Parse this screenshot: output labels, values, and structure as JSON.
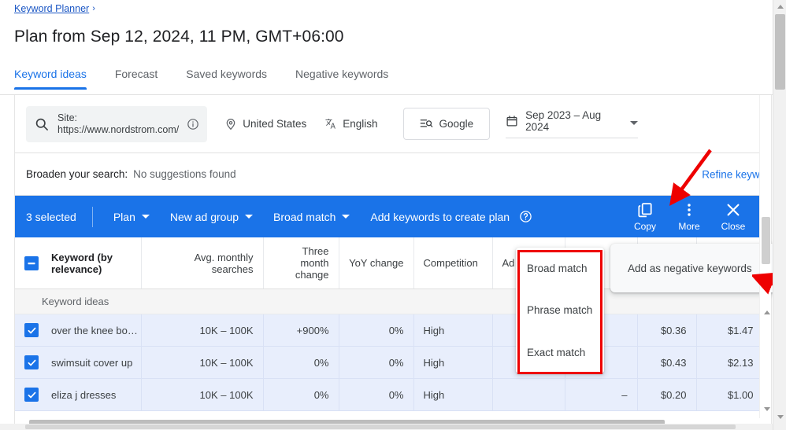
{
  "breadcrumb": {
    "label": "Keyword Planner",
    "separator": "›"
  },
  "page_title": "Plan from Sep 12, 2024, 11 PM, GMT+06:00",
  "tabs": [
    {
      "label": "Keyword ideas",
      "active": true
    },
    {
      "label": "Forecast",
      "active": false
    },
    {
      "label": "Saved keywords",
      "active": false
    },
    {
      "label": "Negative keywords",
      "active": false
    }
  ],
  "filters": {
    "site_label": "Site:",
    "site_url": "https://www.nordstrom.com/",
    "location": "United States",
    "language": "English",
    "search_network": "Google",
    "date_range": "Sep 2023 – Aug 2024"
  },
  "broaden": {
    "label": "Broaden your search:",
    "value": "No suggestions found",
    "refine_link": "Refine keywords"
  },
  "action_bar": {
    "selected_count": "3 selected",
    "plan": "Plan",
    "new_ad_group": "New ad group",
    "match_type": "Broad match",
    "add_keywords": "Add keywords to create plan",
    "copy": "Copy",
    "more": "More",
    "close": "Close"
  },
  "table": {
    "group_label": "Keyword ideas",
    "columns": [
      {
        "key": "keyword",
        "label": "Keyword (by relevance)",
        "align": "left"
      },
      {
        "key": "avg_searches",
        "label": "Avg. monthly searches",
        "align": "right"
      },
      {
        "key": "three_month",
        "label": "Three month change",
        "align": "right"
      },
      {
        "key": "yoy",
        "label": "YoY change",
        "align": "right"
      },
      {
        "key": "competition",
        "label": "Competition",
        "align": "left"
      },
      {
        "key": "ad_share",
        "label": "Ad",
        "align": "right"
      },
      {
        "key": "col7",
        "label": "",
        "align": "right"
      },
      {
        "key": "bid_low",
        "label": "",
        "align": "right"
      },
      {
        "key": "bid_high",
        "label": "",
        "align": "right"
      },
      {
        "key": "col10",
        "label": "",
        "align": "right"
      }
    ],
    "rows": [
      {
        "selected": true,
        "keyword": "over the knee bo…",
        "avg_searches": "10K – 100K",
        "three_month": "+900%",
        "yoy": "0%",
        "competition": "High",
        "ad_share": "",
        "col7": "",
        "bid_low": "$0.36",
        "bid_high": "$1.47",
        "col10": ""
      },
      {
        "selected": true,
        "keyword": "swimsuit cover up",
        "avg_searches": "10K – 100K",
        "three_month": "0%",
        "yoy": "0%",
        "competition": "High",
        "ad_share": "",
        "col7": "",
        "bid_low": "$0.43",
        "bid_high": "$2.13",
        "col10": ""
      },
      {
        "selected": true,
        "keyword": "eliza j dresses",
        "avg_searches": "10K – 100K",
        "three_month": "0%",
        "yoy": "0%",
        "competition": "High",
        "ad_share": "",
        "col7": "–",
        "bid_low": "$0.20",
        "bid_high": "$1.00",
        "col10": ""
      }
    ]
  },
  "match_menu": {
    "items": [
      {
        "label": "Broad match"
      },
      {
        "label": "Phrase match"
      },
      {
        "label": "Exact match"
      }
    ]
  },
  "more_menu": {
    "items": [
      {
        "label": "Add as negative keywords",
        "has_submenu": true
      }
    ]
  },
  "colors": {
    "accent": "#1a73e8",
    "annotation": "#ee0000",
    "row_selected": "#e8eefc",
    "link": "#1a56c4"
  }
}
